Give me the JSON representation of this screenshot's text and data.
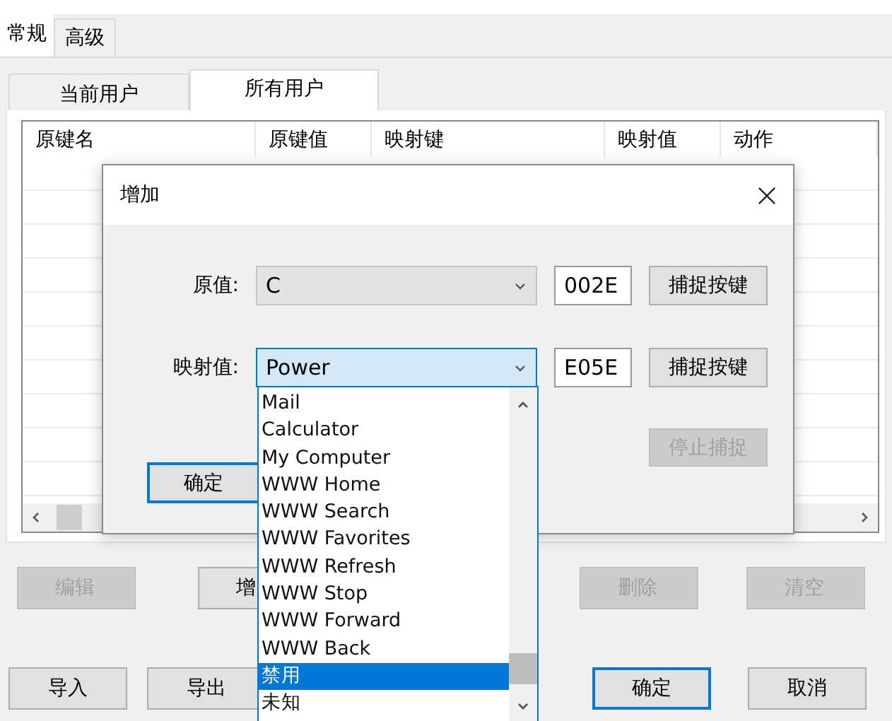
{
  "outer_tabs": [
    {
      "label": "常规",
      "selected": true
    },
    {
      "label": "高级",
      "selected": false
    }
  ],
  "inner_tabs": [
    {
      "label": "当前用户",
      "selected": false
    },
    {
      "label": "所有用户",
      "selected": true
    }
  ],
  "table": {
    "columns": [
      "原键名",
      "原键值",
      "映射键",
      "映射值",
      "动作"
    ]
  },
  "list_buttons": [
    {
      "label": "编辑",
      "disabled": true
    },
    {
      "label": "增",
      "disabled": false
    },
    {
      "label": "删除",
      "disabled": true
    },
    {
      "label": "清空",
      "disabled": true
    }
  ],
  "footer_buttons": [
    {
      "label": "导入",
      "focused": false
    },
    {
      "label": "导出",
      "focused": false
    },
    {
      "label": "确定",
      "focused": true
    },
    {
      "label": "取消",
      "focused": false
    }
  ],
  "dialog": {
    "title": "增加",
    "rows": [
      {
        "label": "原值:",
        "value": "C",
        "disabled": true,
        "code": "002E",
        "button": "捕捉按键"
      },
      {
        "label": "映射值:",
        "value": "Power",
        "disabled": false,
        "code": "E05E",
        "button": "捕捉按键"
      }
    ],
    "stop_button": {
      "label": "停止捕捉",
      "disabled": true
    },
    "ok_button": {
      "label": "确定",
      "focused": true
    },
    "dropdown": {
      "items": [
        {
          "label": "Mail",
          "selected": false
        },
        {
          "label": "Calculator",
          "selected": false
        },
        {
          "label": "My Computer",
          "selected": false
        },
        {
          "label": "WWW Home",
          "selected": false
        },
        {
          "label": "WWW Search",
          "selected": false
        },
        {
          "label": "WWW Favorites",
          "selected": false
        },
        {
          "label": "WWW Refresh",
          "selected": false
        },
        {
          "label": "WWW Stop",
          "selected": false
        },
        {
          "label": "WWW Forward",
          "selected": false
        },
        {
          "label": "WWW Back",
          "selected": false
        },
        {
          "label": "禁用",
          "selected": true
        },
        {
          "label": "未知",
          "selected": false
        }
      ]
    }
  }
}
